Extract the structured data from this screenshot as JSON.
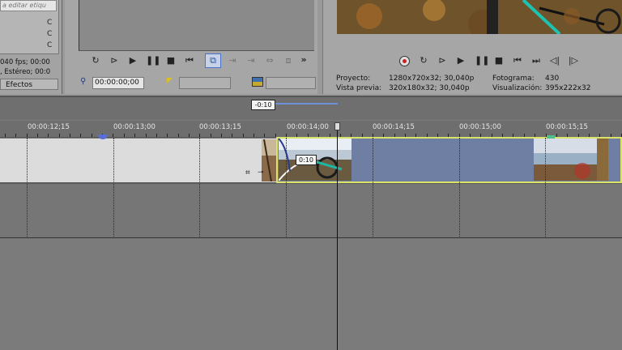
{
  "explorer": {
    "search_placeholder": "a editar etiqu",
    "items": [
      "C",
      "C",
      "C"
    ],
    "fps_line1": "040 fps; 00:00",
    "fps_line2": ", Estéreo; 00:0",
    "tab_effects": "Efectos"
  },
  "trimmer": {
    "time_value": "00:00:00;00",
    "transport": [
      "loop-icon",
      "play-from-start-icon",
      "play-icon",
      "pause-icon",
      "stop-icon",
      "go-to-start-icon",
      "create-selection-icon",
      "add-to-timeline-icon",
      "overwrite-icon",
      "fit-icon",
      "split-icon",
      "more-icon"
    ]
  },
  "preview": {
    "project_label": "Proyecto:",
    "project_value": "1280x720x32; 30,040p",
    "preview_label": "Vista previa:",
    "preview_value": "320x180x32; 30,040p",
    "frame_label": "Fotograma:",
    "frame_value": "430",
    "display_label": "Visualización:",
    "display_value": "395x222x32"
  },
  "timeline": {
    "loop_length": "-0:10",
    "ruler_labels": [
      "00:00:12;15",
      "00:00:13;00",
      "00:00:13;15",
      "00:00:14;00",
      "00:00:14;15",
      "00:00:15;00",
      "00:00:15;15"
    ],
    "fade_label": "0:10"
  },
  "colors": {
    "selected_clip_border": "#d9e36a",
    "clip_blue": "#6f7ea3",
    "loop_region": "#6d8fd8",
    "record_red": "#d02020"
  }
}
